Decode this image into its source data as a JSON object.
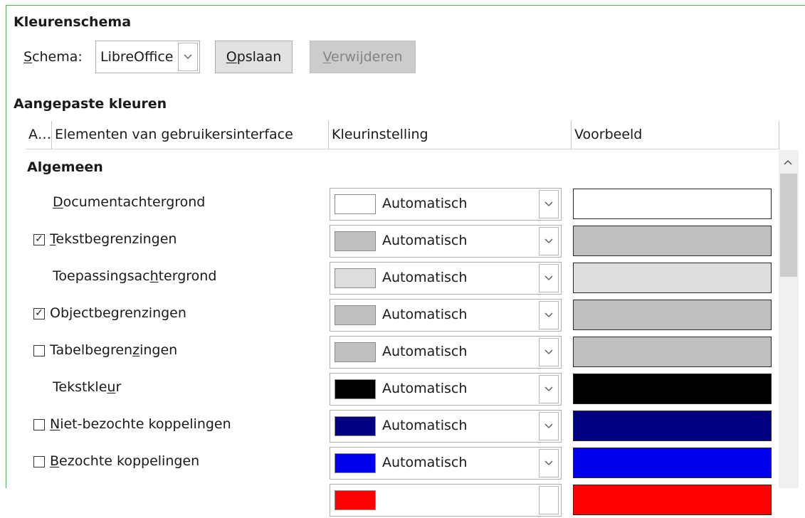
{
  "scheme_section": {
    "title": "Kleurenschema",
    "schema_label": "Schema:",
    "schema_value": "LibreOffice",
    "save_label": "Opslaan",
    "delete_label": "Verwijderen"
  },
  "custom_section": {
    "title": "Aangepaste kleuren",
    "columns": [
      "A…",
      "Elementen van gebruikersinterface",
      "Kleurinstelling",
      "Voorbeeld"
    ],
    "group": "Algemeen"
  },
  "rows": [
    {
      "label": "Documentachtergrond",
      "checkbox": false,
      "checked": false,
      "setting": "Automatisch",
      "color": "#ffffff"
    },
    {
      "label": "Tekstbegrenzingen",
      "checkbox": true,
      "checked": true,
      "setting": "Automatisch",
      "color": "#c0c0c0"
    },
    {
      "label": "Toepassingsachtergrond",
      "checkbox": false,
      "checked": false,
      "setting": "Automatisch",
      "color": "#dddddd"
    },
    {
      "label": "Objectbegrenzingen",
      "checkbox": true,
      "checked": true,
      "setting": "Automatisch",
      "color": "#c0c0c0"
    },
    {
      "label": "Tabelbegrenzingen",
      "checkbox": true,
      "checked": false,
      "setting": "Automatisch",
      "color": "#c0c0c0"
    },
    {
      "label": "Tekstkleur",
      "checkbox": false,
      "checked": false,
      "setting": "Automatisch",
      "color": "#000000"
    },
    {
      "label": "Niet-bezochte koppelingen",
      "checkbox": true,
      "checked": false,
      "setting": "Automatisch",
      "color": "#000080"
    },
    {
      "label": "Bezochte koppelingen",
      "checkbox": true,
      "checked": false,
      "setting": "Automatisch",
      "color": "#0000ee"
    },
    {
      "label": "",
      "checkbox": false,
      "checked": false,
      "setting": "",
      "color": "#ff0000"
    }
  ],
  "icons": {
    "dropdown": "chevron-down-icon",
    "scroll_up": "chevron-up-icon",
    "checkmark": "checkmark-icon"
  }
}
